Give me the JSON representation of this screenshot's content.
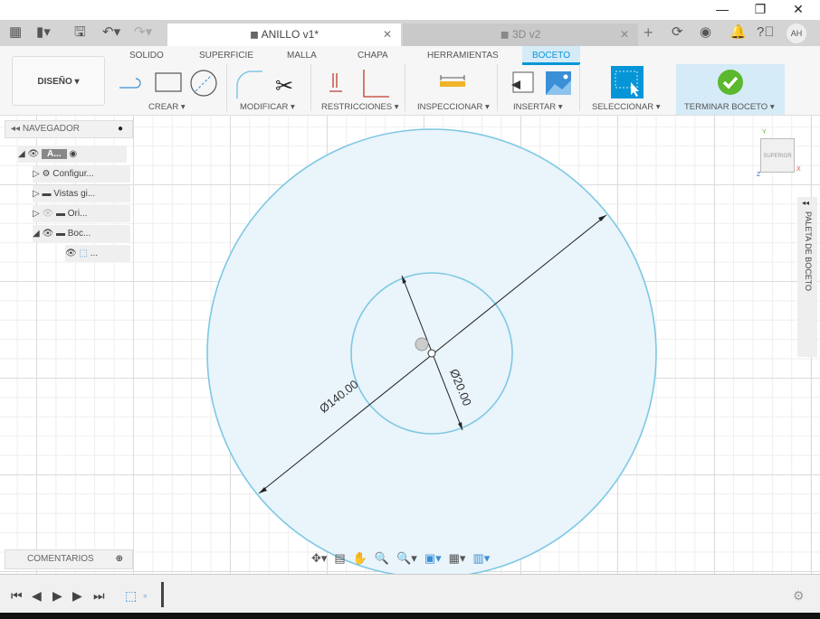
{
  "window": {
    "minimize": "—",
    "restore": "❐",
    "close": "✕"
  },
  "tabs": [
    {
      "label": "ANILLO v1*",
      "active": true
    },
    {
      "label": "3D v2",
      "active": false
    }
  ],
  "user_initials": "AH",
  "workspace": "DISEÑO ▾",
  "ribbon_tabs": [
    "SOLIDO",
    "SUPERFICIE",
    "MALLA",
    "CHAPA",
    "HERRAMIENTAS",
    "BOCETO"
  ],
  "active_ribbon_tab": "BOCETO",
  "groups": {
    "crear": "CREAR ▾",
    "modificar": "MODIFICAR ▾",
    "restricciones": "RESTRICCIONES ▾",
    "inspeccionar": "INSPECCIONAR ▾",
    "insertar": "INSERTAR ▾",
    "seleccionar": "SELECCIONAR ▾",
    "terminar": "TERMINAR BOCETO ▾"
  },
  "browser": {
    "title": "NAVEGADOR",
    "items": [
      "A...",
      "Configur...",
      "Vistas gi...",
      "Ori...",
      "Boc...",
      "..."
    ]
  },
  "comments": "COMENTARIOS",
  "viewcube": {
    "face": "SUPERIOR",
    "x": "X",
    "y": "Y",
    "z": "Z"
  },
  "sketch_palette": "PALETA DE BOCETO",
  "dimensions": {
    "outer": "Ø140.00",
    "inner": "Ø20.00"
  },
  "colors": {
    "accent": "#0696d7",
    "sketch_line": "#7ec8e3",
    "fill": "#e8f4fb",
    "finish": "#5cb82e"
  }
}
